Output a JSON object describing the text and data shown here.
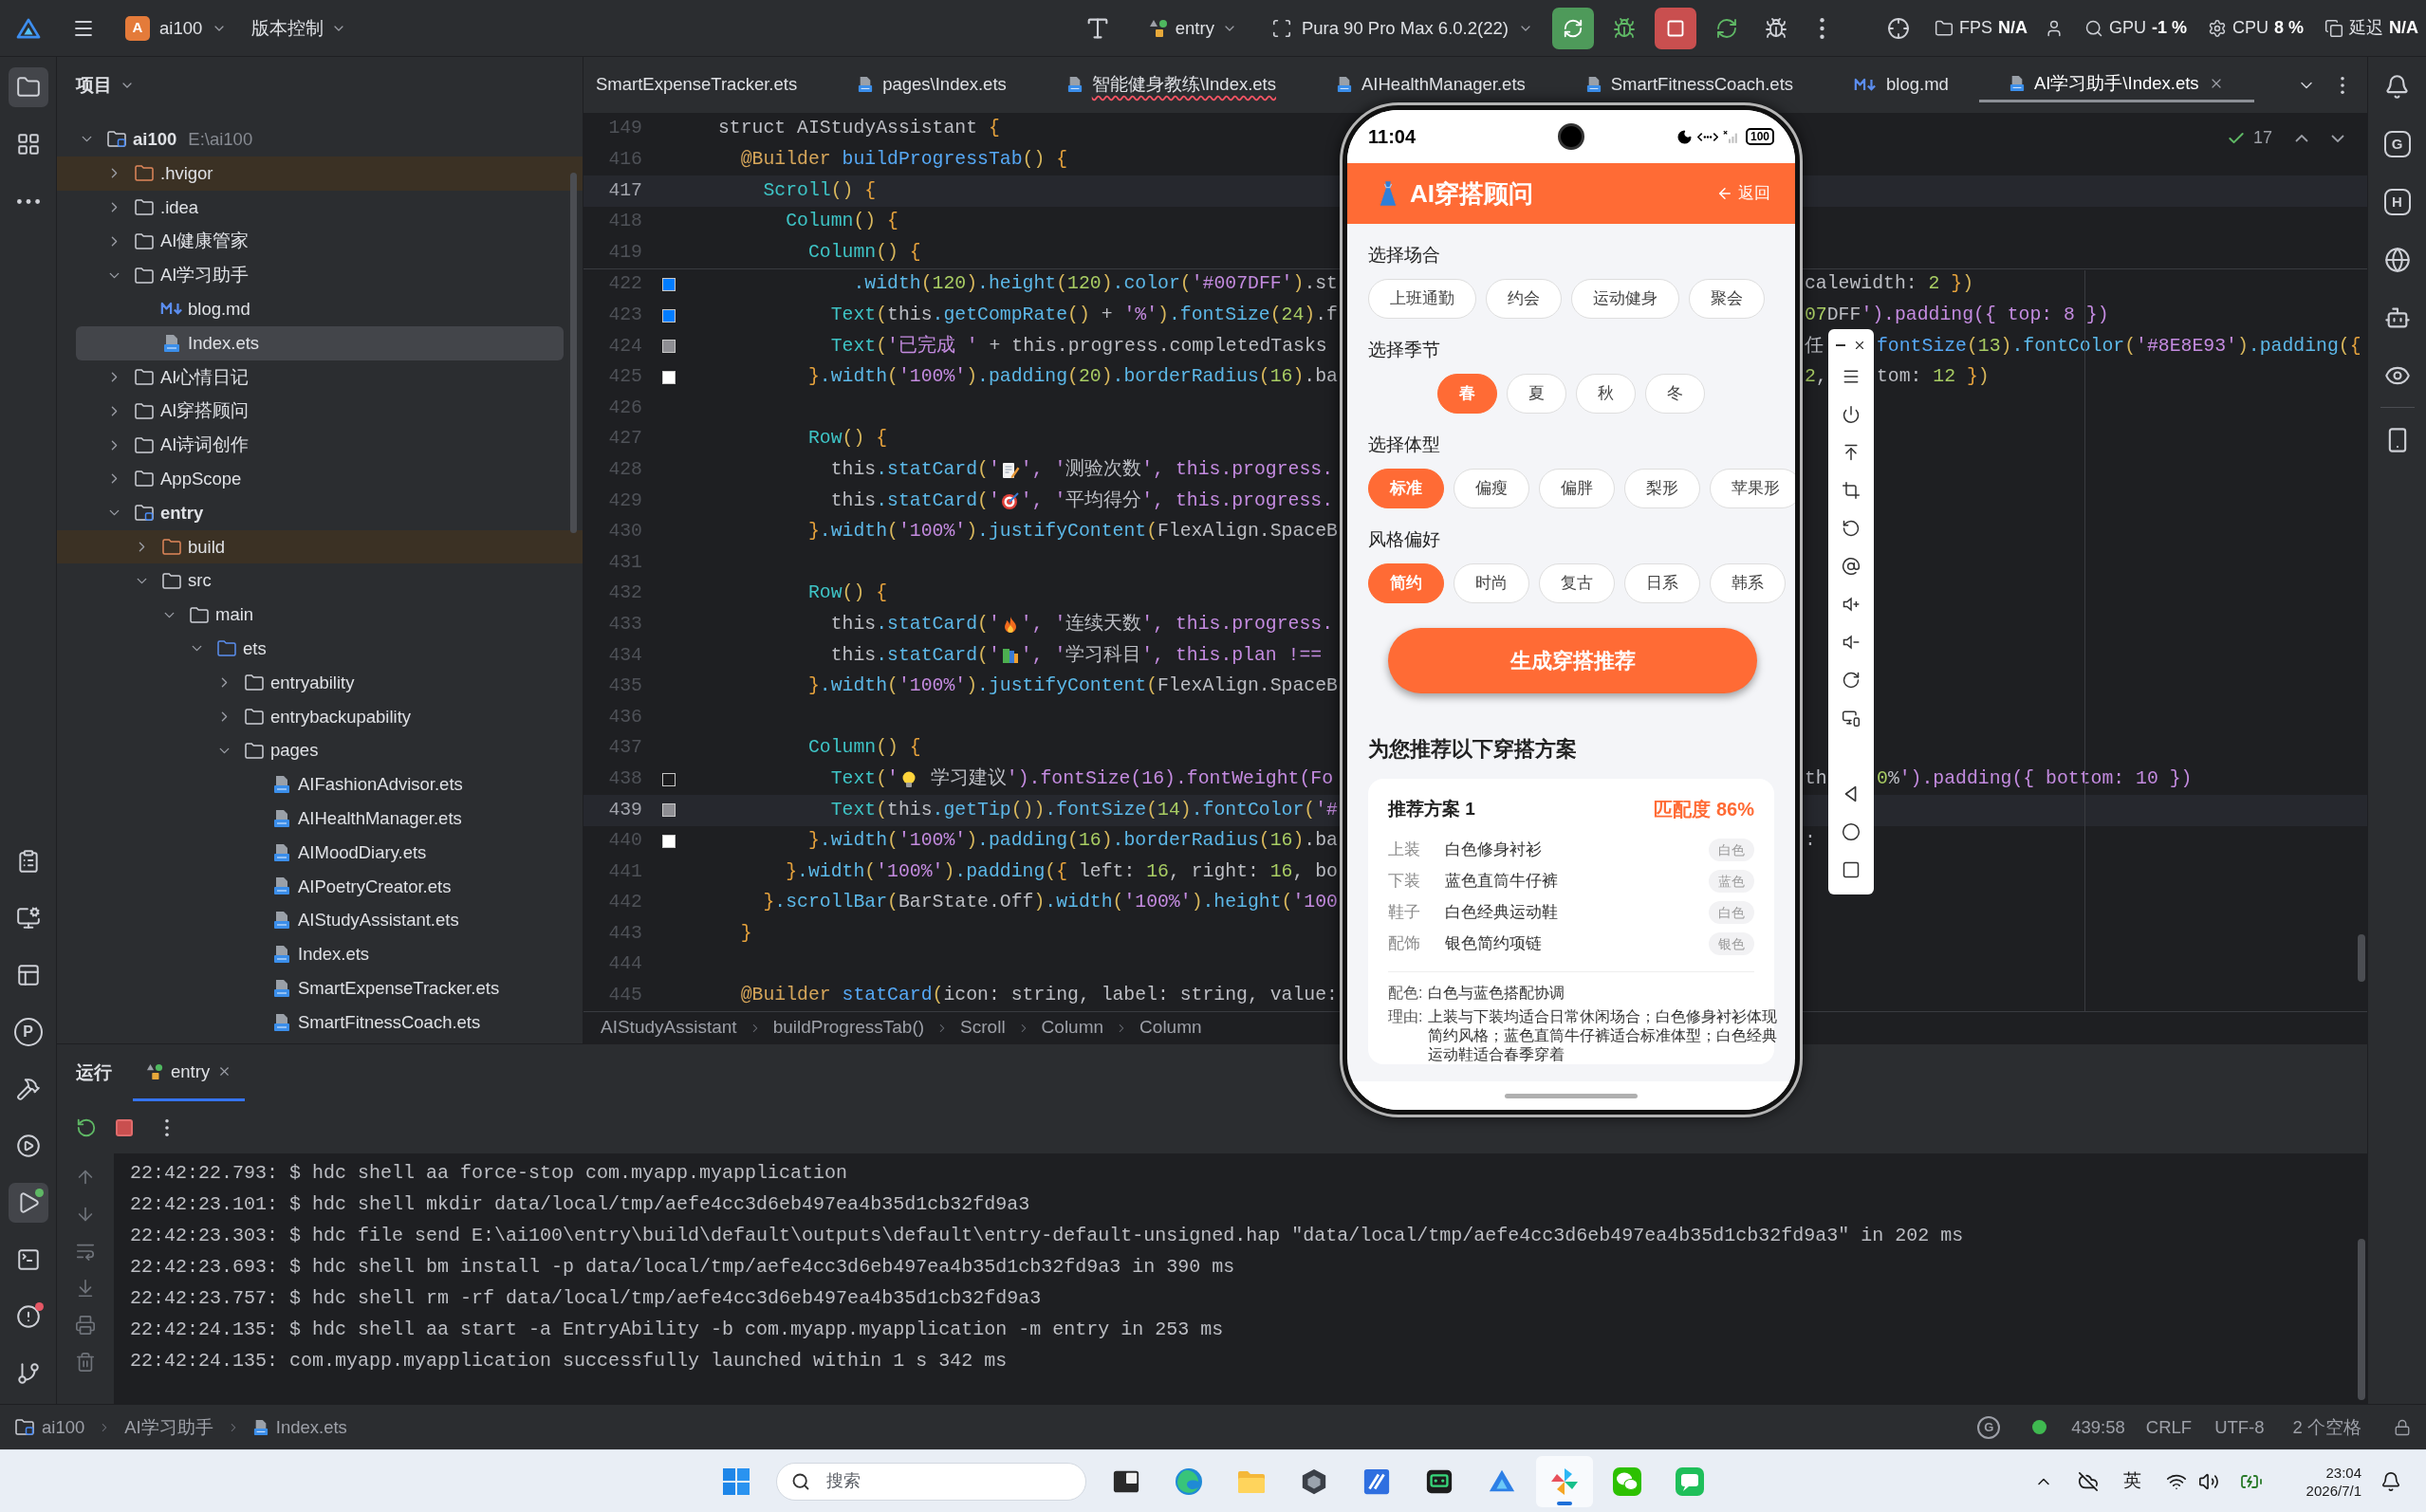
{
  "title_bar": {
    "project_initial": "A",
    "project": "ai100",
    "vcs": "版本控制",
    "run_config": "entry",
    "device": "Pura 90 Pro Max 6.0.2(22)",
    "monitors": [
      {
        "label": "FPS",
        "value": "N/A"
      },
      {
        "label": "GPU",
        "value": "-1 %"
      },
      {
        "label": "CPU",
        "value": "8 %"
      },
      {
        "label": "延迟",
        "value": "N/A"
      }
    ]
  },
  "activity_bar": {
    "top": [
      {
        "selected": true
      },
      {
        "selected": false
      },
      {
        "selected": false
      }
    ],
    "bottom": [
      {
        "selected": false
      },
      {
        "selected": false
      },
      {
        "selected": false
      },
      {
        "selected": false,
        "glyph": "P"
      },
      {
        "selected": false
      },
      {
        "selected": false
      },
      {
        "selected": true,
        "color": "#5fb865"
      },
      {
        "selected": false
      },
      {
        "selected": false,
        "color": "#e55765"
      },
      {
        "selected": false
      }
    ]
  },
  "project_panel": {
    "title": "项目",
    "tree": [
      {
        "label": "ai100",
        "path": "E:\\ai100",
        "kind": "module",
        "expanded": true,
        "selected": false,
        "children": [
          {
            "label": ".hvigor",
            "kind": "excluded",
            "expanded": false,
            "selected": false
          },
          {
            "label": ".idea",
            "kind": "folder",
            "expanded": false,
            "selected": false
          },
          {
            "label": "AI健康管家",
            "kind": "folder",
            "expanded": false,
            "selected": false
          },
          {
            "label": "AI学习助手",
            "kind": "folder",
            "expanded": true,
            "selected": false,
            "children": [
              {
                "label": "blog.md",
                "kind": "markdown",
                "selected": false
              },
              {
                "label": "Index.ets",
                "kind": "ets",
                "selected": true
              }
            ]
          },
          {
            "label": "AI心情日记",
            "kind": "folder",
            "expanded": false,
            "selected": false
          },
          {
            "label": "AI穿搭顾问",
            "kind": "folder",
            "expanded": false,
            "selected": false
          },
          {
            "label": "AI诗词创作",
            "kind": "folder",
            "expanded": false,
            "selected": false
          },
          {
            "label": "AppScope",
            "kind": "folder",
            "expanded": false,
            "selected": false
          },
          {
            "label": "entry",
            "kind": "module",
            "expanded": true,
            "selected": false,
            "children": [
              {
                "label": "build",
                "kind": "excluded",
                "expanded": false,
                "selected": false
              },
              {
                "label": "src",
                "kind": "folder",
                "expanded": true,
                "selected": false,
                "children": [
                  {
                    "label": "main",
                    "kind": "folder",
                    "expanded": true,
                    "selected": false,
                    "children": [
                      {
                        "label": "ets",
                        "kind": "source",
                        "expanded": true,
                        "selected": false,
                        "children": [
                          {
                            "label": "entryability",
                            "kind": "folder",
                            "expanded": false,
                            "selected": false
                          },
                          {
                            "label": "entrybackupability",
                            "kind": "folder",
                            "expanded": false,
                            "selected": false
                          },
                          {
                            "label": "pages",
                            "kind": "folder",
                            "expanded": true,
                            "selected": false,
                            "children": [
                              {
                                "label": "AIFashionAdvisor.ets",
                                "kind": "ets",
                                "selected": false
                              },
                              {
                                "label": "AIHealthManager.ets",
                                "kind": "ets",
                                "selected": false
                              },
                              {
                                "label": "AIMoodDiary.ets",
                                "kind": "ets",
                                "selected": false
                              },
                              {
                                "label": "AIPoetryCreator.ets",
                                "kind": "ets",
                                "selected": false
                              },
                              {
                                "label": "AIStudyAssistant.ets",
                                "kind": "ets",
                                "selected": false
                              },
                              {
                                "label": "Index.ets",
                                "kind": "ets",
                                "selected": false
                              },
                              {
                                "label": "SmartExpenseTracker.ets",
                                "kind": "ets",
                                "selected": false
                              },
                              {
                                "label": "SmartFitnessCoach.ets",
                                "kind": "ets",
                                "selected": false
                              }
                            ]
                          }
                        ]
                      }
                    ]
                  }
                ]
              }
            ]
          }
        ]
      }
    ]
  },
  "editor": {
    "tabs": [
      {
        "label": "SmartExpenseTracker.ets",
        "kind": "plain",
        "selected": false,
        "error": false
      },
      {
        "label": "pages\\Index.ets",
        "kind": "ets",
        "selected": false,
        "error": false
      },
      {
        "label": "智能健身教练\\Index.ets",
        "kind": "ets",
        "selected": false,
        "error": true
      },
      {
        "label": "AIHealthManager.ets",
        "kind": "ets",
        "selected": false,
        "error": false
      },
      {
        "label": "SmartFitnessCoach.ets",
        "kind": "ets",
        "selected": false,
        "error": false
      },
      {
        "label": "blog.md",
        "kind": "markdown",
        "selected": false,
        "error": false
      },
      {
        "label": "AI学习助手\\Index.ets",
        "kind": "ets",
        "selected": true,
        "error": false
      }
    ],
    "inspections": "17",
    "sticky_lines": [
      {
        "number": "149",
        "code": [
          "struct AIStudyAssistant {"
        ],
        "highlighted": false
      },
      {
        "number": "416",
        "code": [
          "  @Builder buildProgressTab() {"
        ],
        "highlighted": false
      },
      {
        "number": "417",
        "code": [
          "    Scroll() {"
        ],
        "highlighted": true
      },
      {
        "number": "418",
        "code": [
          "      Column() {"
        ],
        "highlighted": false
      },
      {
        "number": "419",
        "code": [
          "        Column() {"
        ],
        "highlighted": false
      }
    ],
    "lines": [
      {
        "number": "422",
        "code": [
          "            .width(120).height(120).color('#007DFF').st"
        ],
        "beyond": [
          "calewidth: 2 })"
        ],
        "color": "#007dff",
        "highlighted": false
      },
      {
        "number": "423",
        "code": [
          "          Text(this.getCompRate() + '%').fontSize(24).f"
        ],
        "beyond": [
          "07DFF').padding({ top: 8 })"
        ],
        "color": "#007dff",
        "highlighted": false
      },
      {
        "number": "424",
        "code": [
          "          Text('已完成 ' + this.progress.completedTasks"
        ],
        "beyond": [
          "任",
          "fontSize(13).fontColor('#8E8E93').padding({"
        ],
        "color": "#8e8e93",
        "highlighted": false
      },
      {
        "number": "425",
        "code": [
          "        }.width('100%').padding(20).borderRadius(16).ba"
        ],
        "beyond": [
          "2,",
          "tom: 12 })"
        ],
        "color": "#ffffff",
        "highlighted": false
      },
      {
        "number": "426",
        "highlighted": false
      },
      {
        "number": "427",
        "code": [
          "        Row() {"
        ],
        "highlighted": false
      },
      {
        "number": "428",
        "code": [
          "          this.statCard('",
          "', '测验次数', this.progress."
        ],
        "highlighted": false
      },
      {
        "number": "429",
        "code": [
          "          this.statCard('",
          "', '平均得分', this.progress."
        ],
        "highlighted": false
      },
      {
        "number": "430",
        "code": [
          "        }.width('100%').justifyContent(FlexAlign.SpaceB"
        ],
        "highlighted": false
      },
      {
        "number": "431",
        "highlighted": false
      },
      {
        "number": "432",
        "code": [
          "        Row() {"
        ],
        "highlighted": false
      },
      {
        "number": "433",
        "code": [
          "          this.statCard('",
          "', '连续天数', this.progress."
        ],
        "highlighted": false
      },
      {
        "number": "434",
        "code": [
          "          this.statCard('",
          "', '学习科目', this.plan !=="
        ],
        "highlighted": false
      },
      {
        "number": "435",
        "code": [
          "        }.width('100%').justifyContent(FlexAlign.SpaceB"
        ],
        "highlighted": false
      },
      {
        "number": "436",
        "highlighted": false
      },
      {
        "number": "437",
        "code": [
          "        Column() {"
        ],
        "highlighted": false
      },
      {
        "number": "438",
        "code": [
          "          Text('",
          " 学习建议').fontSize(16).fontWeight(Fo"
        ],
        "beyond": [
          "th",
          "0%').padding({ bottom: 10 })"
        ],
        "color": "#1c1c1e",
        "highlighted": false
      },
      {
        "number": "439",
        "code": [
          "          Text(this.getTip()).fontSize(14).fontColor('#"
        ],
        "color": "#8e8e93",
        "highlighted": true
      },
      {
        "number": "440",
        "code": [
          "        }.width('100%').padding(16).borderRadius(16).ba"
        ],
        "beyond": [
          ":"
        ],
        "color": "#ffffff",
        "highlighted": false
      },
      {
        "number": "441",
        "code": [
          "      }.width('100%').padding({ left: 16, right: 16, bo"
        ],
        "highlighted": false
      },
      {
        "number": "442",
        "code": [
          "    }.scrollBar(BarState.Off).width('100%').height('100"
        ],
        "highlighted": false
      },
      {
        "number": "443",
        "code": [
          "  }"
        ],
        "highlighted": false
      },
      {
        "number": "444",
        "highlighted": false
      },
      {
        "number": "445",
        "code": [
          "  @Builder statCard(icon: string, label: string, value:"
        ],
        "highlighted": false
      }
    ],
    "breadcrumb": [
      "AIStudyAssistant",
      "buildProgressTab()",
      "Scroll",
      "Column",
      "Column"
    ]
  },
  "run_panel": {
    "title": "运行",
    "tabs": [
      {
        "label": "entry",
        "selected": true
      }
    ],
    "console": [
      "22:42:22.793: $ hdc shell aa force-stop com.myapp.myapplication",
      "22:42:23.101: $ hdc shell mkdir data/local/tmp/aefe4cc3d6eb497ea4b35d1cb32fd9a3",
      "22:42:23.303: $ hdc file send E:\\ai100\\entry\\build\\default\\outputs\\default\\entry-default-unsigned.hap \"data/local/tmp/aefe4cc3d6eb497ea4b35d1cb32fd9a3\" in 202 ms",
      "22:42:23.693: $ hdc shell bm install -p data/local/tmp/aefe4cc3d6eb497ea4b35d1cb32fd9a3 in 390 ms",
      "22:42:23.757: $ hdc shell rm -rf data/local/tmp/aefe4cc3d6eb497ea4b35d1cb32fd9a3",
      "22:42:24.135: $ hdc shell aa start -a EntryAbility -b com.myapp.myapplication -m entry in 253 ms",
      "22:42:24.135: com.myapp.myapplication successfully launched within 1 s 342 ms"
    ]
  },
  "right_bar": {
    "glyphs": [
      "G",
      "H"
    ]
  },
  "status_bar": {
    "path": [
      {
        "label": "ai100",
        "kind": "module"
      },
      {
        "label": "AI学习助手",
        "kind": "plain"
      },
      {
        "label": "Index.ets",
        "kind": "ets"
      }
    ],
    "glyph": "G",
    "position": "439:58",
    "line_ending": "CRLF",
    "encoding": "UTF-8",
    "indent": "2 个空格"
  },
  "emulator": {
    "status": {
      "time": "11:04",
      "battery": "100"
    },
    "header": {
      "title": "AI穿搭顾问",
      "back": "返回"
    },
    "sections": [
      {
        "label": "选择场合",
        "options": [
          {
            "label": "上班通勤",
            "selected": false
          },
          {
            "label": "约会",
            "selected": false
          },
          {
            "label": "运动健身",
            "selected": false
          },
          {
            "label": "聚会",
            "selected": false
          }
        ]
      },
      {
        "label": "选择季节",
        "options": [
          {
            "label": "春",
            "selected": true
          },
          {
            "label": "夏",
            "selected": false
          },
          {
            "label": "秋",
            "selected": false
          },
          {
            "label": "冬",
            "selected": false
          }
        ]
      },
      {
        "label": "选择体型",
        "options": [
          {
            "label": "标准",
            "selected": true
          },
          {
            "label": "偏瘦",
            "selected": false
          },
          {
            "label": "偏胖",
            "selected": false
          },
          {
            "label": "梨形",
            "selected": false
          },
          {
            "label": "苹果形",
            "selected": false
          }
        ]
      },
      {
        "label": "风格偏好",
        "options": [
          {
            "label": "简约",
            "selected": true
          },
          {
            "label": "时尚",
            "selected": false
          },
          {
            "label": "复古",
            "selected": false
          },
          {
            "label": "日系",
            "selected": false
          },
          {
            "label": "韩系",
            "selected": false
          }
        ]
      }
    ],
    "generate_button": "生成穿搭推荐",
    "results_title": "为您推荐以下穿搭方案",
    "plans": [
      {
        "title": "推荐方案 1",
        "match": "匹配度 86%",
        "items": [
          {
            "slot": "上装",
            "name": "白色修身衬衫",
            "tag": "白色"
          },
          {
            "slot": "下装",
            "name": "蓝色直筒牛仔裤",
            "tag": "蓝色"
          },
          {
            "slot": "鞋子",
            "name": "白色经典运动鞋",
            "tag": "白色"
          },
          {
            "slot": "配饰",
            "name": "银色简约项链",
            "tag": "银色"
          }
        ],
        "notes": [
          {
            "label": "配色:",
            "text": "白色与蓝色搭配协调"
          },
          {
            "label": "理由:",
            "text": "上装与下装均适合日常休闲场合；白色修身衬衫体现简约风格；蓝色直筒牛仔裤适合标准体型；白色经典运动鞋适合春季穿着"
          }
        ]
      }
    ]
  },
  "taskbar": {
    "search": {
      "placeholder": "搜索"
    },
    "apps": [
      {
        "active": false
      },
      {
        "active": false
      },
      {
        "active": false
      },
      {
        "active": false
      },
      {
        "active": false
      },
      {
        "active": false
      },
      {
        "active": false
      },
      {
        "active": true
      },
      {
        "active": false
      },
      {
        "active": false
      }
    ],
    "ime": "英",
    "time": "23:04",
    "date": "2026/7/1"
  }
}
